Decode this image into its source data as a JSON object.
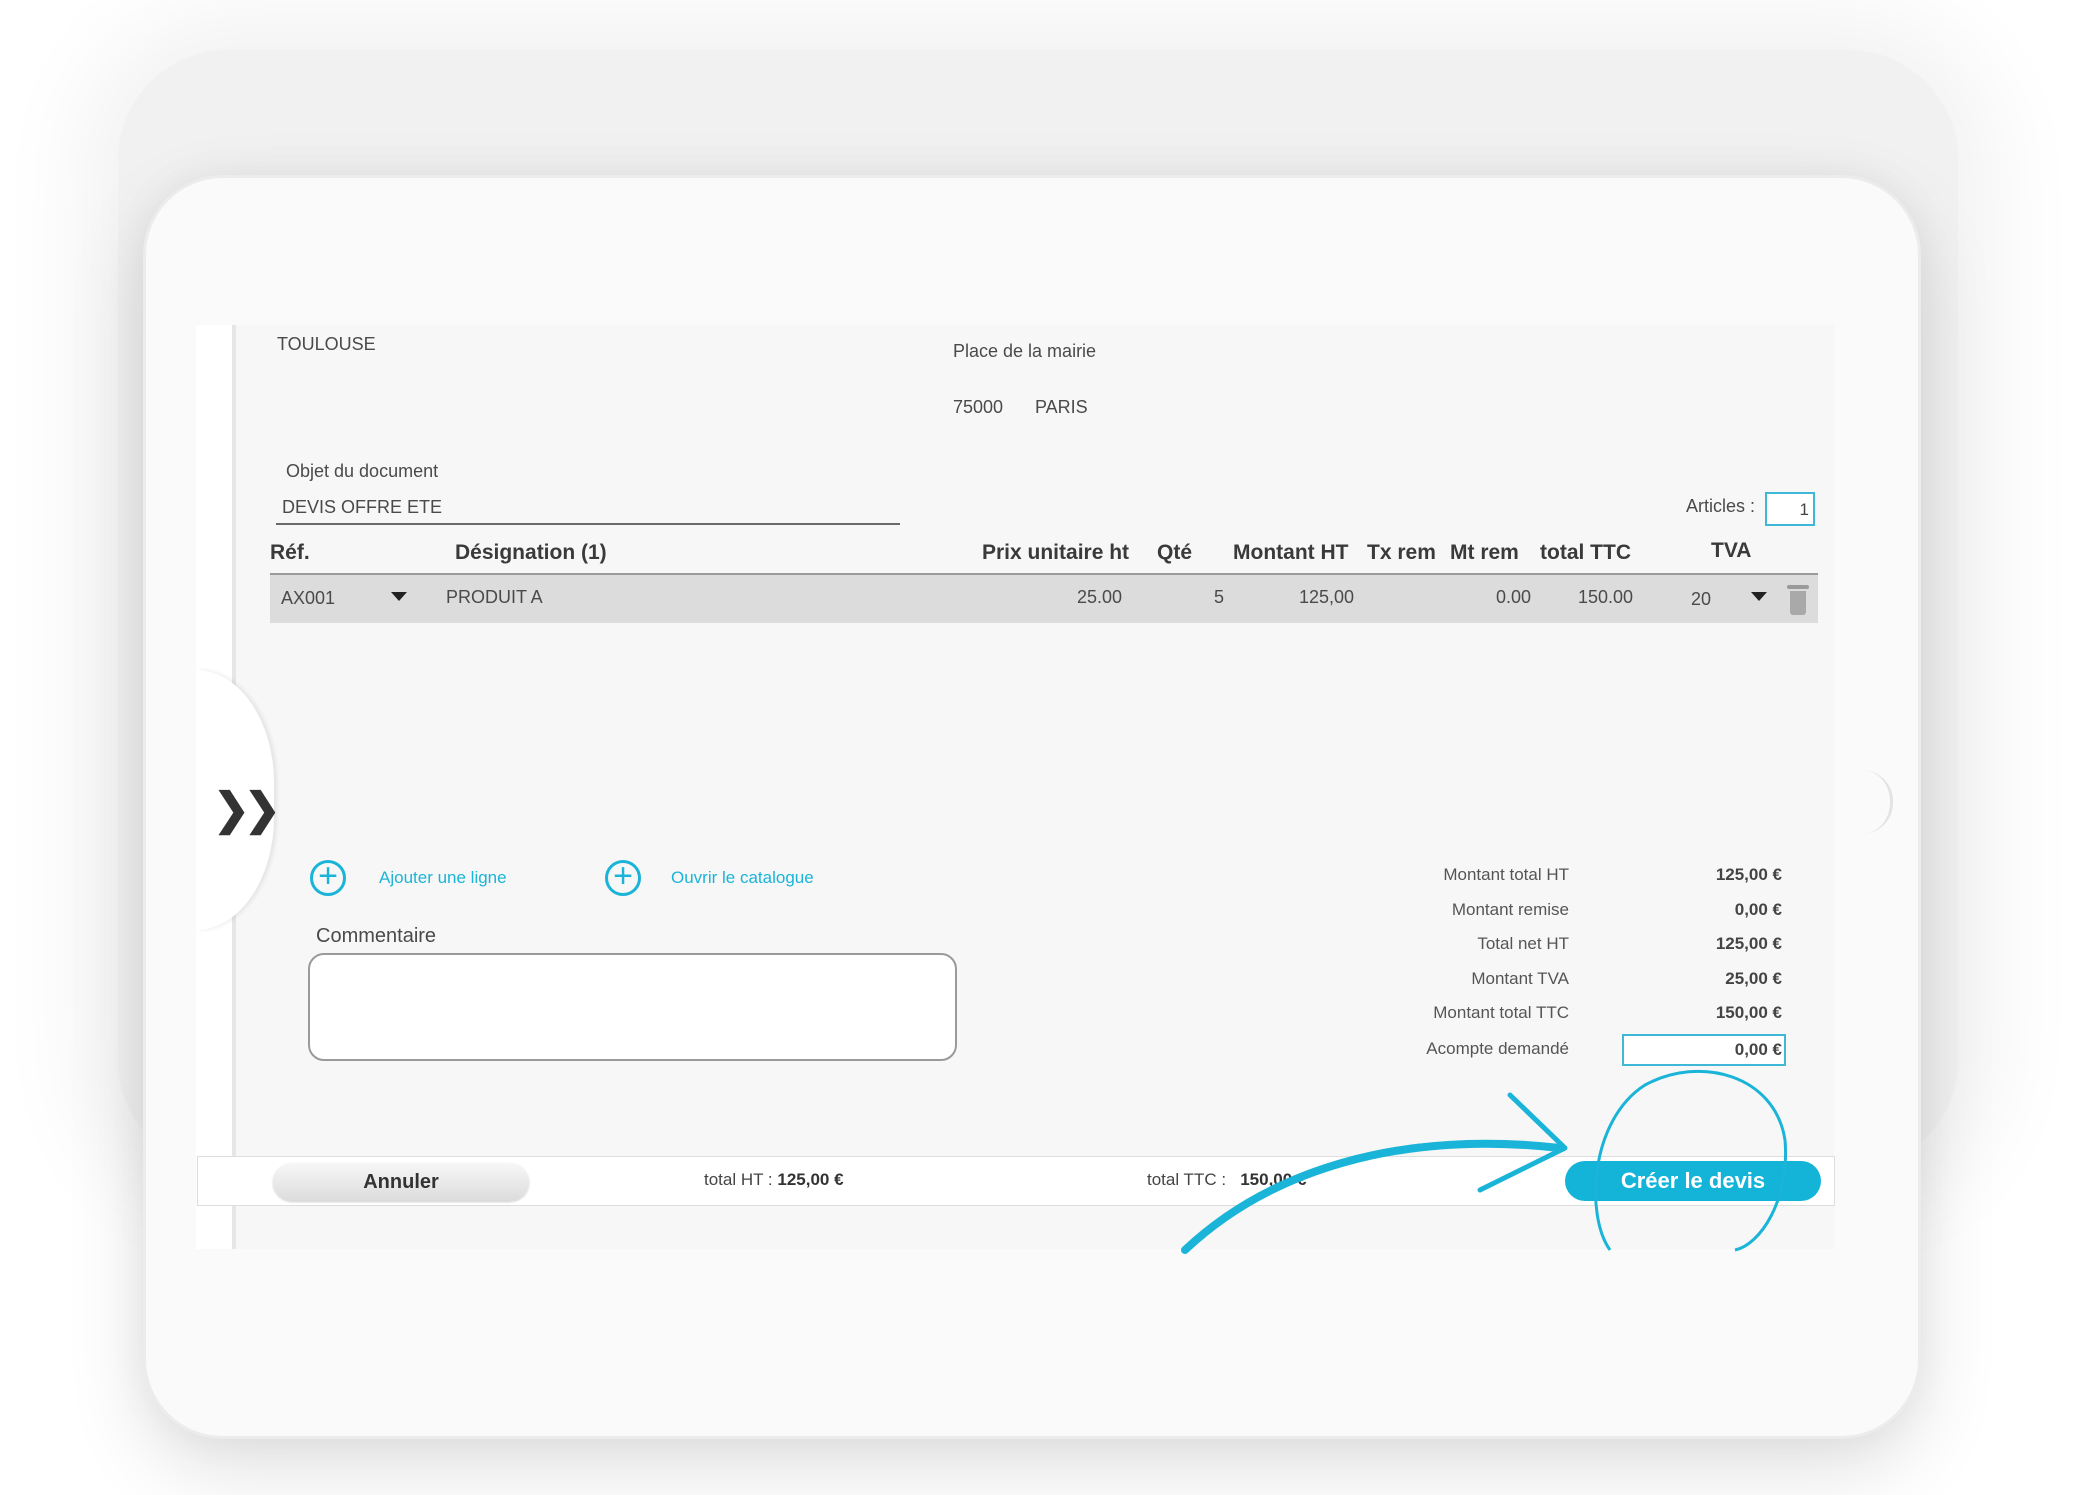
{
  "client": {
    "city": "TOULOUSE"
  },
  "destinataire": {
    "street": "Place de la mairie",
    "postcode": "75000",
    "city": "PARIS"
  },
  "document": {
    "object_label": "Objet du document",
    "object_value": "DEVIS OFFRE ETE"
  },
  "articles": {
    "label": "Articles :",
    "count": "1"
  },
  "table": {
    "headers": {
      "ref": "Réf.",
      "designation": "Désignation (1)",
      "prix": "Prix unitaire ht",
      "qte": "Qté",
      "montant_ht": "Montant HT",
      "tx_rem": "Tx rem",
      "mt_rem": "Mt rem",
      "total_ttc": "total TTC",
      "tva": "TVA"
    },
    "rows": [
      {
        "ref": "AX001",
        "designation": "PRODUIT A",
        "prix": "25.00",
        "qte": "5",
        "montant_ht": "125,00",
        "mt_rem": "0.00",
        "total_ttc": "150.00",
        "tva": "20"
      }
    ]
  },
  "actions": {
    "add_line": "Ajouter une ligne",
    "open_catalog": "Ouvrir le catalogue"
  },
  "comment": {
    "label": "Commentaire",
    "value": ""
  },
  "summary": {
    "montant_total_ht_label": "Montant total HT",
    "montant_total_ht": "125,00 €",
    "montant_remise_label": "Montant remise",
    "montant_remise": "0,00 €",
    "total_net_ht_label": "Total net HT",
    "total_net_ht": "125,00 €",
    "montant_tva_label": "Montant TVA",
    "montant_tva": "25,00 €",
    "montant_total_ttc_label": "Montant total TTC",
    "montant_total_ttc": "150,00 €",
    "acompte_label": "Acompte demandé",
    "acompte": "0,00 €"
  },
  "footer": {
    "cancel_label": "Annuler",
    "total_ht_label": "total HT :",
    "total_ht": "125,00 €",
    "total_ttc_label": "total TTC :",
    "total_ttc": "150,00 €",
    "create_label": "Créer le devis"
  },
  "colors": {
    "accent": "#14b4d8",
    "annotation": "#1ab4d8"
  },
  "icons": {
    "expand": "double-chevron-right-icon",
    "add": "plus-circle-icon",
    "delete": "trash-icon",
    "dropdown": "caret-down-icon"
  }
}
